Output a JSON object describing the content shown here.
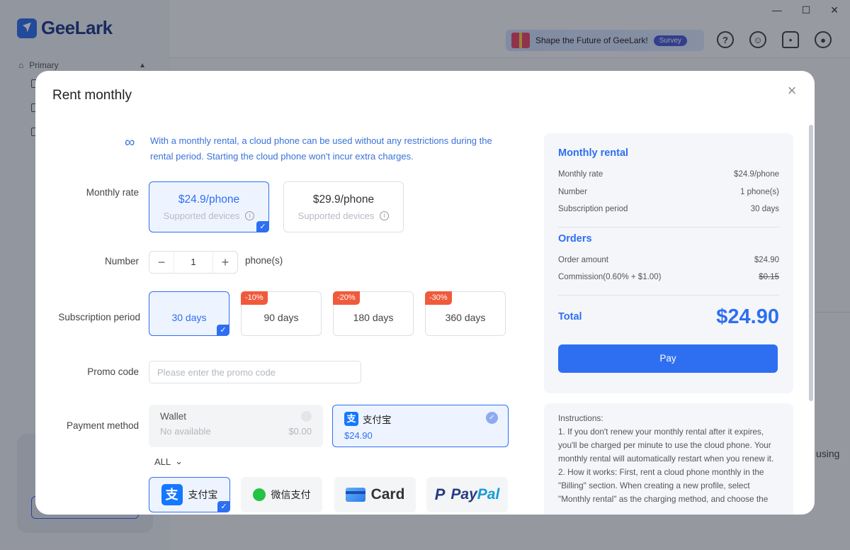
{
  "app": {
    "brand": "GeeLark",
    "nav_primary": "Primary",
    "survey_text": "Shape the Future of GeeLark!",
    "survey_badge": "Survey",
    "bg_text": "using"
  },
  "modal": {
    "title": "Rent monthly",
    "close": "×",
    "info": "With a monthly rental, a cloud phone can be used without any restrictions during the rental period. Starting the cloud phone won't incur extra charges.",
    "labels": {
      "rate": "Monthly rate",
      "number": "Number",
      "period": "Subscription period",
      "promo": "Promo code",
      "payment": "Payment method"
    },
    "rates": [
      {
        "price": "$24.9/phone",
        "sub": "Supported devices",
        "selected": true
      },
      {
        "price": "$29.9/phone",
        "sub": "Supported devices",
        "selected": false
      }
    ],
    "number": {
      "minus": "−",
      "value": "1",
      "plus": "+",
      "unit": "phone(s)"
    },
    "periods": [
      {
        "label": "30 days",
        "discount": "",
        "selected": true
      },
      {
        "label": "90 days",
        "discount": "-10%",
        "selected": false
      },
      {
        "label": "180 days",
        "discount": "-20%",
        "selected": false
      },
      {
        "label": "360 days",
        "discount": "-30%",
        "selected": false
      }
    ],
    "promo_placeholder": "Please enter the promo code",
    "wallet": {
      "label": "Wallet",
      "status": "No available",
      "amount": "$0.00"
    },
    "alipay_selected": {
      "label": "支付宝",
      "amount": "$24.90"
    },
    "all_label": "ALL",
    "methods": [
      {
        "label": "支付宝",
        "icon": "alipay-icon",
        "selected": true
      },
      {
        "label": "微信支付",
        "icon": "wechat-pay-icon",
        "selected": false
      },
      {
        "label": "Card",
        "icon": "card-icon",
        "selected": false
      },
      {
        "label": "PayPal",
        "icon": "paypal-icon",
        "selected": false
      }
    ]
  },
  "summary": {
    "rental_title": "Monthly rental",
    "rental_rows": [
      {
        "label": "Monthly rate",
        "value": "$24.9/phone"
      },
      {
        "label": "Number",
        "value": "1 phone(s)"
      },
      {
        "label": "Subscription period",
        "value": "30 days"
      }
    ],
    "orders_title": "Orders",
    "order_rows": [
      {
        "label": "Order amount",
        "value": "$24.90"
      },
      {
        "label": "Commission(0.60% + $1.00)",
        "value": "$0.15"
      }
    ],
    "total_label": "Total",
    "total_value": "$24.90",
    "pay_label": "Pay"
  },
  "instructions": {
    "title": "Instructions:",
    "item1": "1. If you don't renew your monthly rental after it expires, you'll be charged per minute to use the cloud phone. Your monthly rental will automatically restart when you renew it.",
    "item2": "2. How it works: First, rent a cloud phone monthly in the \"Billing\" section. When creating a new profile, select \"Monthly rental\" as the charging method, and choose the"
  }
}
